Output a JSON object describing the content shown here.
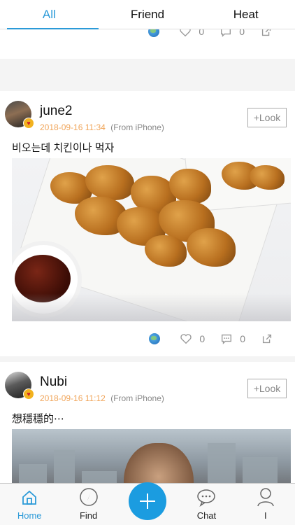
{
  "tabs": [
    {
      "label": "All",
      "active": true
    },
    {
      "label": "Friend",
      "active": false
    },
    {
      "label": "Heat",
      "active": false
    }
  ],
  "prev_post": {
    "likes": "0",
    "comments": "0"
  },
  "posts": [
    {
      "username": "june2",
      "timestamp": "2018-09-16 11:34",
      "source": "(From iPhone)",
      "look_label": "+Look",
      "text": "비오는데 치킨이나 먹자",
      "image": "fried-chicken-photo",
      "likes": "0",
      "comments": "0"
    },
    {
      "username": "Nubi",
      "timestamp": "2018-09-16 11:12",
      "source": "(From iPhone)",
      "look_label": "+Look",
      "text": "想穩穩的⋯",
      "image": "city-window-photo"
    }
  ],
  "bottom_nav": [
    {
      "label": "Home",
      "icon": "home-icon",
      "active": true
    },
    {
      "label": "Find",
      "icon": "compass-icon",
      "active": false
    },
    {
      "label": "",
      "icon": "plus-icon",
      "active": false
    },
    {
      "label": "Chat",
      "icon": "chat-bubble-icon",
      "active": false
    },
    {
      "label": "I",
      "icon": "person-icon",
      "active": false
    }
  ],
  "colors": {
    "accent": "#2b9ad8",
    "timestamp": "#f0a55a",
    "fab": "#1b9ce0"
  }
}
